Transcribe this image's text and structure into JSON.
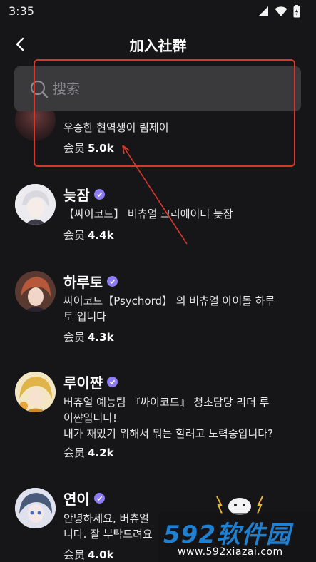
{
  "status_bar": {
    "time": "3:35"
  },
  "header": {
    "title": "加入社群"
  },
  "search": {
    "placeholder": "搜索"
  },
  "communities": [
    {
      "name": "",
      "desc_lines": [
        "우중한 현역생이 림제이"
      ],
      "members_label": "会员",
      "members_count": "5.0k"
    },
    {
      "name": "늦잠",
      "desc_lines": [
        "【싸이코드】 버츄얼 크리에이터 늦잠"
      ],
      "members_label": "会员",
      "members_count": "4.4k"
    },
    {
      "name": "하루토",
      "desc_lines": [
        "싸이코드【Psychord】 의 버츄얼 아이돌 하루",
        "토 입니다"
      ],
      "members_label": "会员",
      "members_count": "4.3k"
    },
    {
      "name": "루이쨘",
      "desc_lines": [
        "버츄얼 예능팀 『싸이코드』 청초담당 리더 루",
        "이쨘입니다!",
        "내가 재밌기 위해서 뭐든 할려고 노력중입니다?"
      ],
      "members_label": "会员",
      "members_count": "4.2k"
    },
    {
      "name": "연이",
      "desc_lines": [
        "안녕하세요, 버츄얼",
        "니다. 잘 부탁드려요"
      ],
      "members_label": "会员",
      "members_count": "4.0k"
    }
  ],
  "watermark": {
    "brand": "592软件园",
    "url": "www.592xiazai.com"
  },
  "colors": {
    "background": "#161618",
    "search_bg": "#3a3a3d",
    "verified": "#8d7cf5",
    "annotation": "#d8382c",
    "watermark_blue": "#1f7fd0"
  }
}
